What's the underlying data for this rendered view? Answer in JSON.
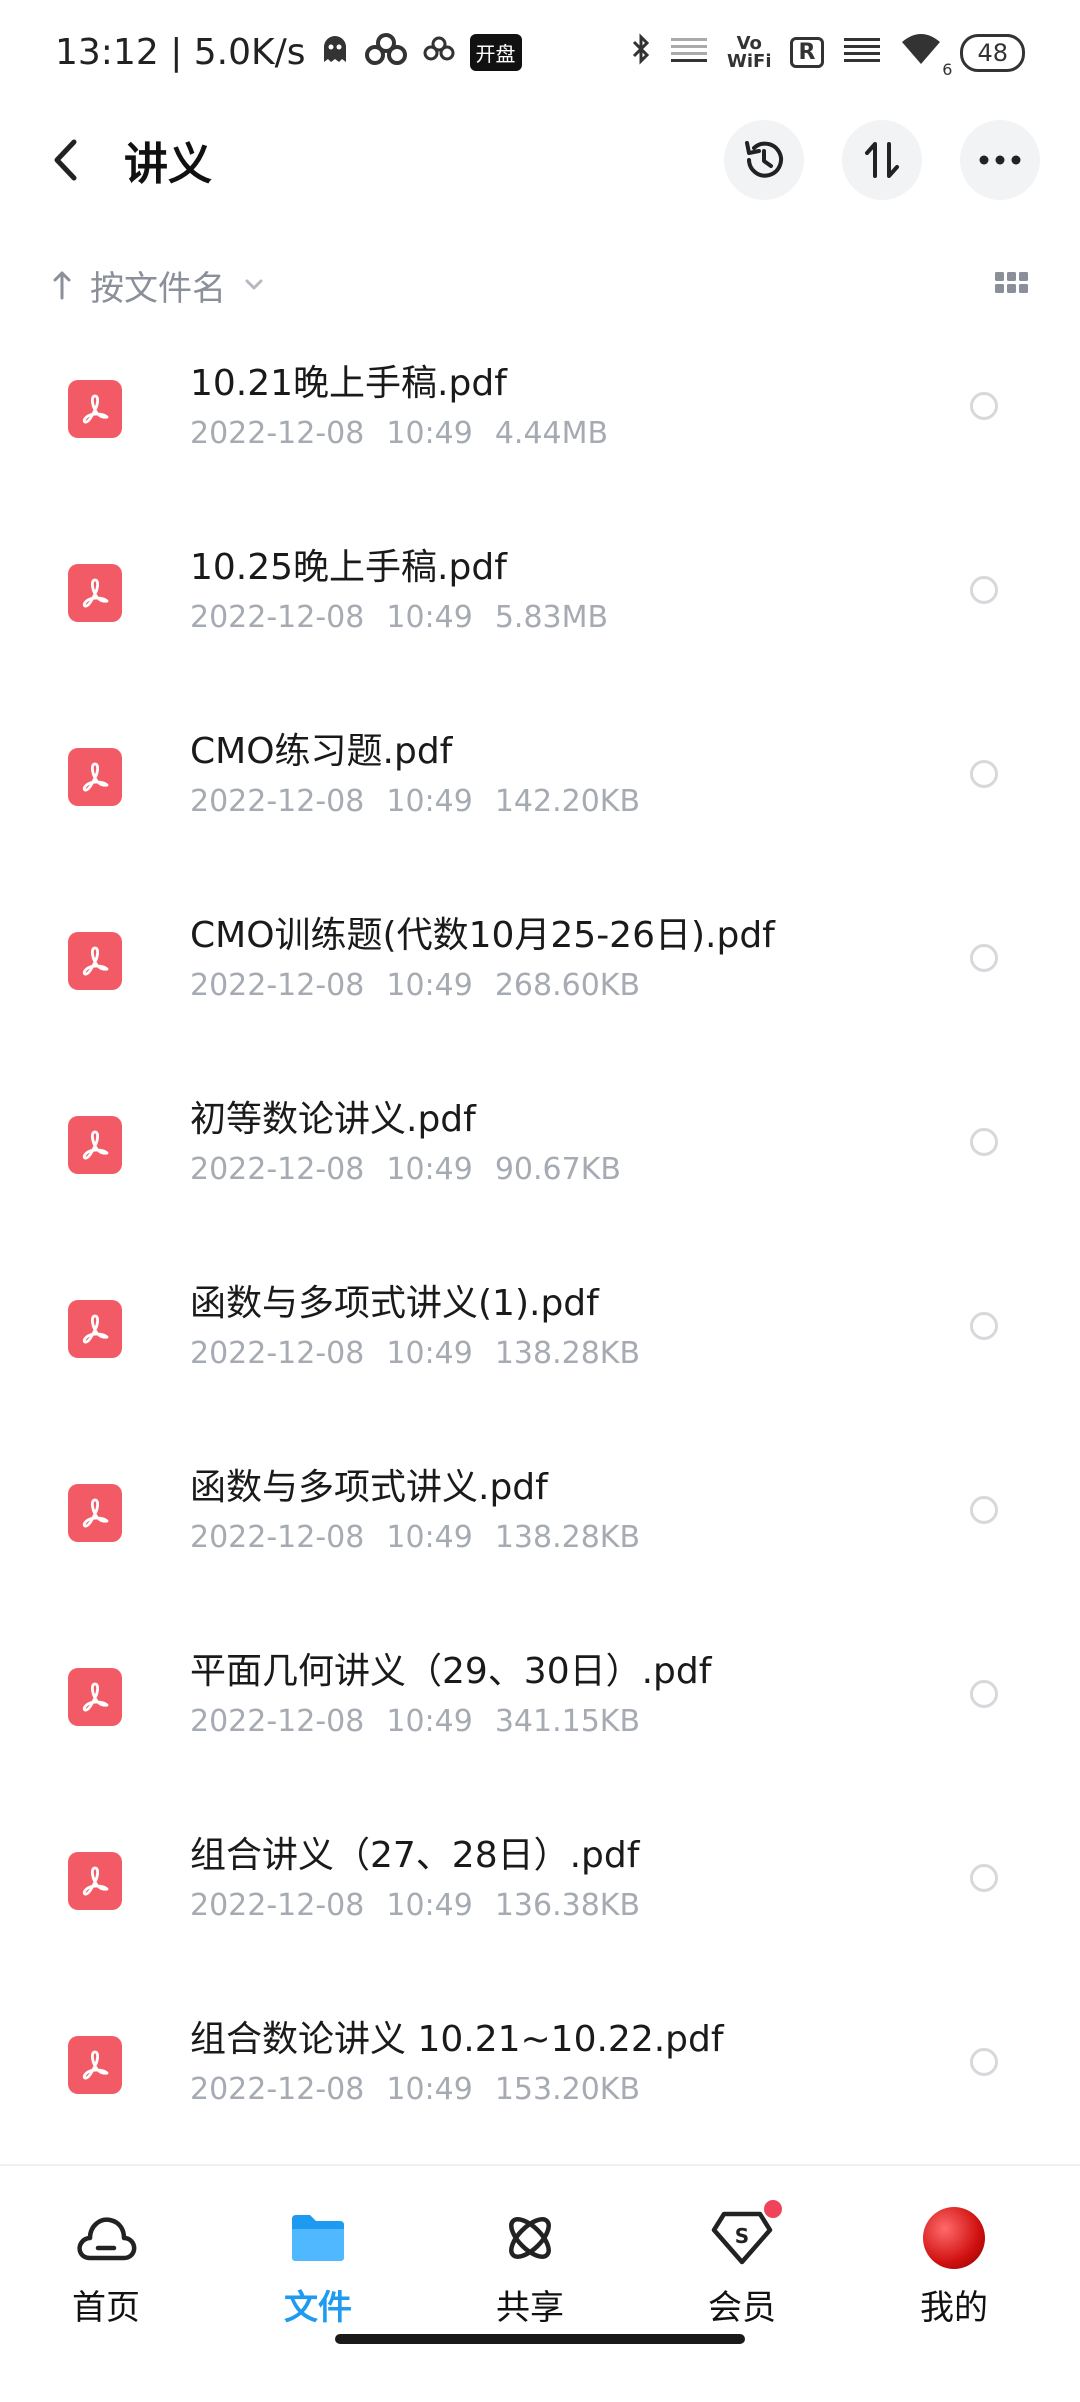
{
  "status_bar": {
    "time_speed": "13:12 | 5.0K/s",
    "badge": "开盘",
    "vowifi_top": "Vo",
    "vowifi_bottom": "WiFi",
    "r_badge": "R",
    "signal_sub": "6",
    "battery": "48"
  },
  "header": {
    "title": "讲义"
  },
  "sort": {
    "label": "按文件名"
  },
  "files": [
    {
      "name": "10.21晚上手稿.pdf",
      "date": "2022-12-08",
      "time": "10:49",
      "size": "4.44MB"
    },
    {
      "name": "10.25晚上手稿.pdf",
      "date": "2022-12-08",
      "time": "10:49",
      "size": "5.83MB"
    },
    {
      "name": "CMO练习题.pdf",
      "date": "2022-12-08",
      "time": "10:49",
      "size": "142.20KB"
    },
    {
      "name": "CMO训练题(代数10月25-26日).pdf",
      "date": "2022-12-08",
      "time": "10:49",
      "size": "268.60KB"
    },
    {
      "name": "初等数论讲义.pdf",
      "date": "2022-12-08",
      "time": "10:49",
      "size": "90.67KB"
    },
    {
      "name": "函数与多项式讲义(1).pdf",
      "date": "2022-12-08",
      "time": "10:49",
      "size": "138.28KB"
    },
    {
      "name": "函数与多项式讲义.pdf",
      "date": "2022-12-08",
      "time": "10:49",
      "size": "138.28KB"
    },
    {
      "name": "平面几何讲义（29、30日）.pdf",
      "date": "2022-12-08",
      "time": "10:49",
      "size": "341.15KB"
    },
    {
      "name": "组合讲义（27、28日）.pdf",
      "date": "2022-12-08",
      "time": "10:49",
      "size": "136.38KB"
    },
    {
      "name": "组合数论讲义 10.21~10.22.pdf",
      "date": "2022-12-08",
      "time": "10:49",
      "size": "153.20KB"
    }
  ],
  "nav": {
    "home": "首页",
    "files": "文件",
    "share": "共享",
    "member": "会员",
    "mine": "我的"
  },
  "colors": {
    "accent": "#1e9bf0",
    "pdf_red": "#f25b65",
    "meta_gray": "#a6abb3",
    "notify_dot": "#f0435a"
  }
}
